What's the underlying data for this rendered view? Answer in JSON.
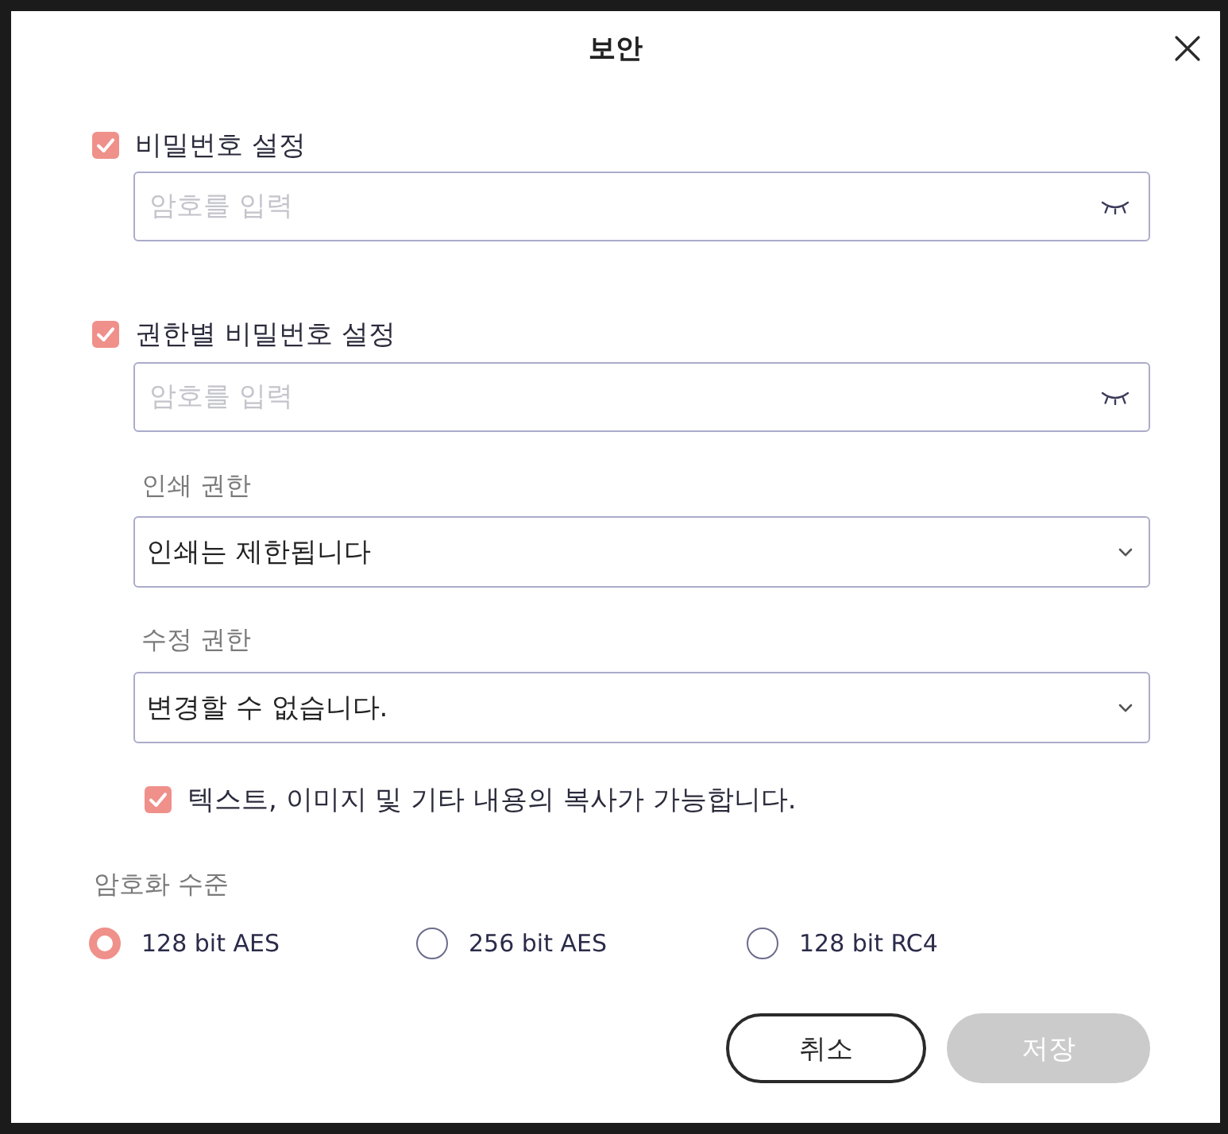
{
  "dialog": {
    "title": "보안"
  },
  "password": {
    "checked": true,
    "label": "비밀번호 설정",
    "placeholder": "암호를 입력"
  },
  "permission_password": {
    "checked": true,
    "label": "권한별 비밀번호 설정",
    "placeholder": "암호를 입력"
  },
  "print_permission": {
    "label": "인쇄 권한",
    "value": "인쇄는 제한됩니다"
  },
  "edit_permission": {
    "label": "수정 권한",
    "value": "변경할 수 없습니다."
  },
  "copy_option": {
    "checked": true,
    "label": "텍스트, 이미지 및 기타 내용의 복사가 가능합니다."
  },
  "encryption": {
    "label": "암호화 수준",
    "options": [
      {
        "label": "128 bit AES",
        "selected": true
      },
      {
        "label": "256 bit AES",
        "selected": false
      },
      {
        "label": "128 bit RC4",
        "selected": false
      }
    ]
  },
  "buttons": [
    {
      "label": "취소",
      "kind": "outline",
      "disabled": false
    },
    {
      "label": "저장",
      "kind": "filled",
      "disabled": true
    }
  ]
}
